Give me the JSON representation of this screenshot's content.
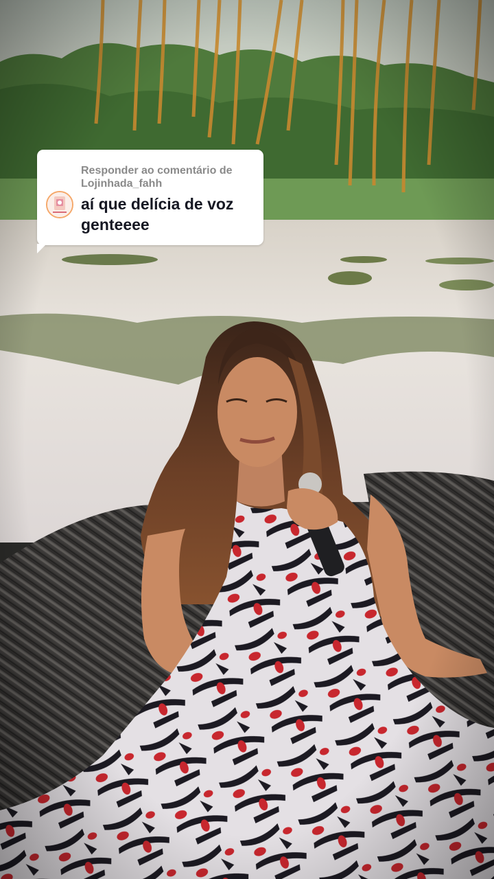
{
  "reply_sticker": {
    "header_line1": "Responder ao comentário de",
    "header_line2": "Lojinhada_fahh",
    "comment_line1": "aí que delícia de voz",
    "comment_line2": "genteeee",
    "avatar_icon": "profile-avatar"
  },
  "colors": {
    "card_background": "#ffffff",
    "header_text": "#8a8a8a",
    "comment_text": "#161823",
    "avatar_ring": "#f5a86a"
  }
}
